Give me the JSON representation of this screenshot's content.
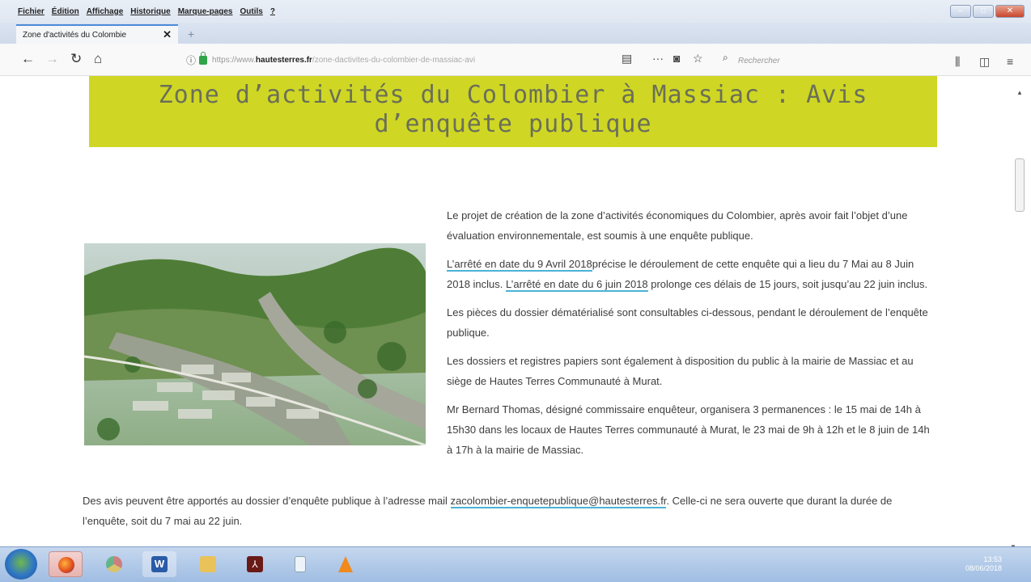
{
  "browser": {
    "menu": [
      "Fichier",
      "Édition",
      "Affichage",
      "Historique",
      "Marque-pages",
      "Outils",
      "?"
    ],
    "tab_title": "Zone d'activités du Colombie",
    "tab_close": "✕",
    "url_prefix": "https://www.",
    "url_host": "hautesterres.fr",
    "url_path": "/zone-dactivites-du-colombier-de-massiac-avi",
    "search_placeholder": "Rechercher"
  },
  "page": {
    "title_line1": "Zone d’activités du Colombier à Massiac : Avis",
    "title_line2": "d’enquête publique",
    "p1": "Le projet de création de la zone d’activités économiques du Colombier, après avoir fait l’objet d’une évaluation environnementale, est soumis à une enquête publique.",
    "p2_link1": "L’arrêté en date du 9 Avril 2018",
    "p2_mid": "précise le déroulement de cette enquête qui a lieu du 7 Mai au 8 Juin 2018 inclus. ",
    "p2_link2": "L’arrêté en date du 6 juin 2018",
    "p2_end": " prolonge ces délais de 15 jours, soit jusqu’au 22 juin inclus.",
    "p3": "Les pièces du dossier dématérialisé sont consultables ci-dessous, pendant le déroulement de l’enquête publique.",
    "p4": "Les dossiers et registres papiers sont également à disposition du public à la mairie de Massiac et au siège de Hautes Terres Communauté à Murat.",
    "p5": "Mr Bernard Thomas, désigné commissaire enquêteur, organisera 3 permanences : le 15 mai de 14h à 15h30 dans les locaux de Hautes Terres communauté à Murat, le 23 mai de 9h à 12h et le 8 juin de 14h à 17h à la mairie de Massiac.",
    "p6_start": "Des avis peuvent être apportés au dossier d’enquête publique à l’adresse mail ",
    "p6_email": "zacolombier-enquetepublique@hautesterres.fr",
    "p6_end": ". Celle-ci ne sera ouverte que durant la durée de l’enquête, soit du 7 mai au 22 juin."
  },
  "taskbar": {
    "apps": [
      "firefox",
      "chrome",
      "word",
      "file-explorer",
      "acrobat",
      "notepad",
      "vlc"
    ],
    "clock_time": "13:53",
    "clock_date": "08/06/2018"
  },
  "colors": {
    "banner": "#cfd724",
    "link_underline": "#4bb3d6"
  }
}
